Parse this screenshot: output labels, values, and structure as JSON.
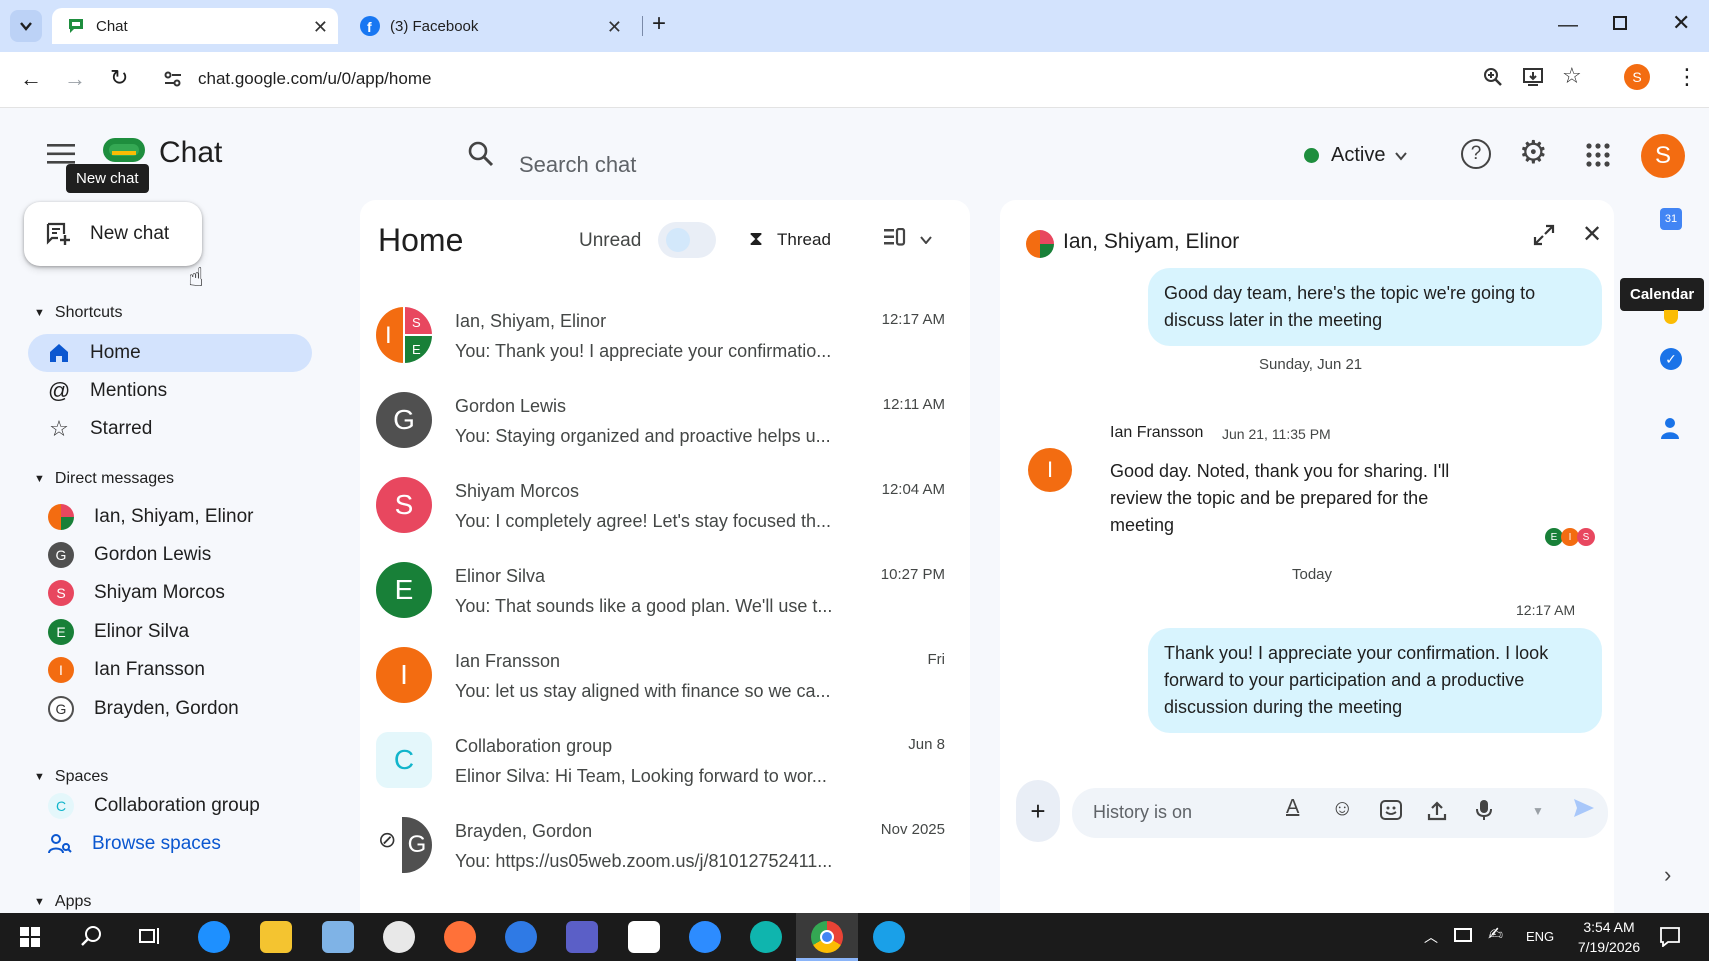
{
  "browser": {
    "tabs": [
      {
        "title": "Chat"
      },
      {
        "title": "(3) Facebook"
      }
    ],
    "url": "chat.google.com/u/0/app/home",
    "profile_initial": "S"
  },
  "header": {
    "app_title": "Chat",
    "tooltip_new_chat": "New chat",
    "search_placeholder": "Search chat",
    "status_label": "Active",
    "avatar_initial": "S"
  },
  "sidebar": {
    "new_chat_label": "New chat",
    "shortcuts_title": "Shortcuts",
    "shortcuts": [
      {
        "label": "Home"
      },
      {
        "label": "Mentions"
      },
      {
        "label": "Starred"
      }
    ],
    "dm_title": "Direct messages",
    "dms": [
      {
        "label": "Ian, Shiyam, Elinor"
      },
      {
        "label": "Gordon Lewis",
        "initial": "G"
      },
      {
        "label": "Shiyam Morcos",
        "initial": "S"
      },
      {
        "label": "Elinor Silva",
        "initial": "E"
      },
      {
        "label": "Ian Fransson",
        "initial": "I"
      },
      {
        "label": "Brayden, Gordon",
        "initial": "G"
      }
    ],
    "spaces_title": "Spaces",
    "spaces": [
      {
        "label": "Collaboration group",
        "initial": "C"
      }
    ],
    "browse_spaces_label": "Browse spaces",
    "apps_title": "Apps"
  },
  "home": {
    "title": "Home",
    "unread_label": "Unread",
    "thread_label": "Thread",
    "conversations": [
      {
        "name": "Ian, Shiyam, Elinor",
        "snippet": "You: Thank you! I appreciate your confirmatio...",
        "time": "12:17 AM",
        "initials": [
          "I",
          "S",
          "E"
        ]
      },
      {
        "name": "Gordon Lewis",
        "snippet": "You: Staying organized and proactive helps u...",
        "time": "12:11 AM",
        "initial": "G"
      },
      {
        "name": "Shiyam Morcos",
        "snippet": "You: I completely agree! Let's stay focused th...",
        "time": "12:04 AM",
        "initial": "S"
      },
      {
        "name": "Elinor Silva",
        "snippet": "You: That sounds like a good plan. We'll use t...",
        "time": "10:27 PM",
        "initial": "E"
      },
      {
        "name": "Ian Fransson",
        "snippet": "You: let us stay aligned with finance so we ca...",
        "time": "Fri",
        "initial": "I"
      },
      {
        "name": "Collaboration group",
        "snippet": "Elinor Silva: Hi Team, Looking forward to wor...",
        "time": "Jun 8",
        "initial": "C"
      },
      {
        "name": "Brayden, Gordon",
        "snippet": "You: https://us05web.zoom.us/j/81012752411...",
        "time": "Nov 2025",
        "initial": "G"
      }
    ]
  },
  "thread": {
    "title": "Ian, Shiyam, Elinor",
    "msg1": "Good day team, here's the topic we're going to discuss later in the meeting",
    "date1": "Sunday, Jun 21",
    "sender": "Ian Fransson",
    "sender_time": "Jun 21, 11:35 PM",
    "sender_initial": "I",
    "msg2": "Good day. Noted, thank you for sharing. I'll review the topic and be prepared for the meeting",
    "read_initials": [
      "E",
      "I",
      "S"
    ],
    "date2": "Today",
    "time3": "12:17 AM",
    "msg3": "Thank you! I appreciate your confirmation. I look forward to your participation and a productive discussion during the meeting",
    "compose_placeholder": "History is on"
  },
  "rightbar": {
    "calendar_day": "31",
    "calendar_tooltip": "Calendar"
  },
  "taskbar": {
    "lang": "ENG",
    "time": "3:54 AM",
    "date": "7/19/2026"
  },
  "colors": {
    "accent": "#0b57d0",
    "active_green": "#1e8e3e",
    "orange": "#f36c11",
    "gray_avatar": "#505050",
    "pink": "#e8475f",
    "green": "#188038",
    "bubble": "#d8f4fe"
  }
}
